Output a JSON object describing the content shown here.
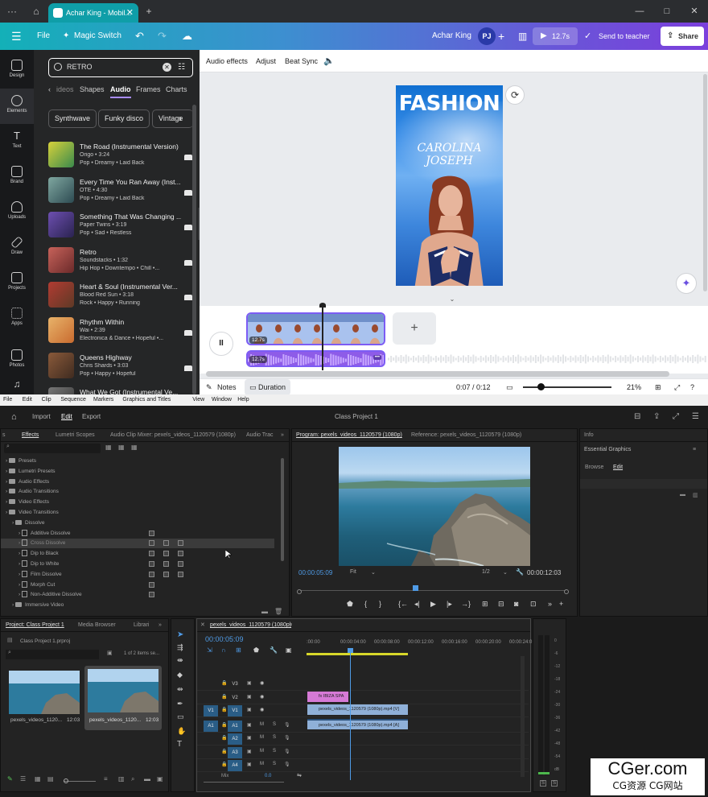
{
  "browser": {
    "tab_title": "Achar King - Mobil...",
    "tab_close": "✕",
    "new_tab": "+",
    "menu_dots": "···",
    "win_min": "—",
    "win_max": "□",
    "win_close": "✕"
  },
  "canva": {
    "top": {
      "file": "File",
      "magic_switch": "Magic Switch",
      "undo": "↶",
      "redo": "↷",
      "user_name": "Achar King",
      "avatar_initials": "PJ",
      "add": "+",
      "duration": "12.7s",
      "send_to_teacher": "Send to teacher",
      "share": "Share"
    },
    "rail": [
      {
        "label": "Design"
      },
      {
        "label": "Elements"
      },
      {
        "label": "Text"
      },
      {
        "label": "Brand"
      },
      {
        "label": "Uploads"
      },
      {
        "label": "Draw"
      },
      {
        "label": "Projects"
      },
      {
        "label": "Apps"
      },
      {
        "label": "Photos"
      }
    ],
    "search_value": "RETRO",
    "category_tabs": [
      "ideos",
      "Shapes",
      "Audio",
      "Frames",
      "Charts"
    ],
    "category_prev": "‹",
    "chips": [
      "Synthwave",
      "Funky disco",
      "Vintage"
    ],
    "chips_next": "›",
    "tracks": [
      {
        "title": "The Road (Instrumental Version)",
        "artist": "Origo • 3:24",
        "genre": "Pop • Dreamy • Laid Back",
        "c1": "#d7d13b",
        "c2": "#3a8a4c"
      },
      {
        "title": "Every Time You Ran Away (Inst...",
        "artist": "OTE • 4:30",
        "genre": "Pop • Dreamy • Laid Back",
        "c1": "#7fa7a0",
        "c2": "#2d4b52"
      },
      {
        "title": "Something That Was Changing ...",
        "artist": "Paper Twins • 3:19",
        "genre": "Pop • Sad • Restless",
        "c1": "#6d4fb0",
        "c2": "#2a2350"
      },
      {
        "title": "Retro",
        "artist": "Soundstacks • 1:32",
        "genre": "Hip Hop • Downtempo • Chill •...",
        "c1": "#c7625a",
        "c2": "#6b2a2a"
      },
      {
        "title": "Heart & Soul (Instrumental Ver...",
        "artist": "Blood Red Sun • 3:18",
        "genre": "Rock • Happy • Running",
        "c1": "#b23b32",
        "c2": "#5e3a26"
      },
      {
        "title": "Rhythm Within",
        "artist": "Wai • 2:39",
        "genre": "Electronica & Dance • Hopeful •...",
        "c1": "#e8b36a",
        "c2": "#c96b2f"
      },
      {
        "title": "Queens Highway",
        "artist": "Chris Shards • 3:03",
        "genre": "Pop • Happy • Hopeful",
        "c1": "#8a5a3a",
        "c2": "#3f2b20"
      },
      {
        "title": "What We Got (Instrumental Ve...",
        "artist": "",
        "genre": "",
        "c1": "#777777",
        "c2": "#333333"
      }
    ],
    "ctx": {
      "audio_effects": "Audio effects",
      "adjust": "Adjust",
      "beat_sync": "Beat Sync"
    },
    "poster": {
      "title": "FASHION",
      "name": "CAROLINA JOSEPH"
    },
    "clip_badge": "12.7s",
    "audio_badge": "12.7s",
    "add_clip": "+",
    "pause": "II",
    "clip_more": "•••",
    "bottom": {
      "notes": "Notes",
      "duration": "Duration",
      "time": "0:07 / 0:12",
      "zoom": "21%"
    }
  },
  "premiere": {
    "menu": [
      "File",
      "Edit",
      "Clip",
      "Sequence",
      "Markers",
      "Graphics and Titles",
      "View",
      "Window",
      "Help"
    ],
    "header": {
      "import": "Import",
      "edit": "Edit",
      "export": "Export",
      "project_title": "Class Project 1"
    },
    "effects_tabs": [
      "s",
      "Effects",
      "Lumetri Scopes",
      "Audio Clip Mixer: pexels_videos_1120579 (1080p)",
      "Audio Trac"
    ],
    "effects_tree": [
      {
        "label": "Presets",
        "indent": 0,
        "type": "folder"
      },
      {
        "label": "Lumetri Presets",
        "indent": 0,
        "type": "folder"
      },
      {
        "label": "Audio Effects",
        "indent": 0,
        "type": "folder"
      },
      {
        "label": "Audio Transitions",
        "indent": 0,
        "type": "folder"
      },
      {
        "label": "Video Effects",
        "indent": 0,
        "type": "folder"
      },
      {
        "label": "Video Transitions",
        "indent": 0,
        "type": "folder"
      },
      {
        "label": "Dissolve",
        "indent": 1,
        "type": "folder"
      },
      {
        "label": "Additive Dissolve",
        "indent": 2,
        "type": "doc",
        "badges": 1
      },
      {
        "label": "Cross Dissolve",
        "indent": 2,
        "type": "doc",
        "badges": 3,
        "selected": true
      },
      {
        "label": "Dip to Black",
        "indent": 2,
        "type": "doc",
        "badges": 3
      },
      {
        "label": "Dip to White",
        "indent": 2,
        "type": "doc",
        "badges": 3
      },
      {
        "label": "Film Dissolve",
        "indent": 2,
        "type": "doc",
        "badges": 3
      },
      {
        "label": "Morph Cut",
        "indent": 2,
        "type": "doc",
        "badges": 1
      },
      {
        "label": "Non-Additive Dissolve",
        "indent": 2,
        "type": "doc",
        "badges": 1
      },
      {
        "label": "Immersive Video",
        "indent": 1,
        "type": "folder"
      }
    ],
    "program": {
      "tab_program": "Program: pexels_videos_1120579 (1080p)",
      "tab_reference": "Reference: pexels_videos_1120579 (1080p)",
      "timecode": "00:00:05:09",
      "fit": "Fit",
      "fraction": "1/2",
      "duration": "00:00:12:03"
    },
    "info": {
      "title": "Info",
      "essential": "Essential Graphics",
      "browse": "Browse",
      "edit": "Edit"
    },
    "project": {
      "tabs": [
        "Project: Class Project 1",
        "Media Browser",
        "Librari"
      ],
      "file": "Class Project 1.prproj",
      "count": "1 of 2 items se...",
      "items": [
        {
          "name": "pexels_videos_1120...",
          "dur": "12:03"
        },
        {
          "name": "pexels_videos_1120...",
          "dur": "12:03"
        }
      ]
    },
    "timeline": {
      "seq_tab": "pexels_videos_1120579 (1080p)",
      "timecode": "00:00:05:09",
      "ruler": [
        ":00:00",
        "00:00:04:00",
        "00:00:08:00",
        "00:00:12:00",
        "00:00:16:00",
        "00:00:20:00",
        "00:00:24:0"
      ],
      "tracks": [
        "V3",
        "V2",
        "V1",
        "A1",
        "A2",
        "A3",
        "A4"
      ],
      "mix_label": "Mix",
      "mix_value": "0.0",
      "graphic_clip": "fx  IBIZA SPA",
      "video_clip": "pexels_videos_1120579 (1080p).mp4 [V]",
      "audio_clip": "pexels_videos_1120579 (1080p).mp4 [A]"
    },
    "meter_ticks": [
      "0",
      "-6",
      "-12",
      "-18",
      "-24",
      "-30",
      "-36",
      "-42",
      "-48",
      "-54",
      "dB"
    ]
  },
  "watermark": {
    "line1": "CGer.com",
    "line2": "CG资源 CG网站"
  }
}
